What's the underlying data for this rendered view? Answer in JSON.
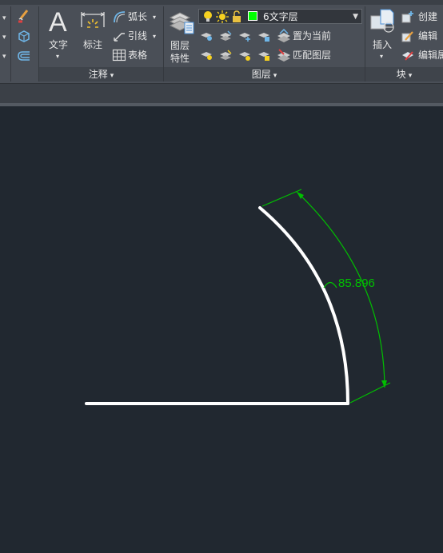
{
  "annotation_panel": {
    "text_label": "文字",
    "dimension_label": "标注",
    "arc_length_label": "弧长",
    "leader_label": "引线",
    "table_label": "表格",
    "title": "注释"
  },
  "layers_panel": {
    "layer_properties_label_1": "图层",
    "layer_properties_label_2": "特性",
    "current_layer": "6文字层",
    "current_layer_color": "#00ff00",
    "set_current_label": "置为当前",
    "match_layer_label": "匹配图层",
    "title": "图层"
  },
  "block_panel": {
    "insert_label": "插入",
    "create_label": "创建",
    "edit_label": "编辑",
    "edit_attr_label": "编辑属",
    "title": "块"
  },
  "drawing": {
    "dimension_value": "85.896",
    "background": "#212830",
    "line_color": "#ffffff",
    "dimension_color": "#00c000"
  },
  "icons": [
    "brush-icon",
    "cube-icon",
    "offset-icon",
    "text-A-icon",
    "dimension-icon",
    "arc-length-icon",
    "leader-icon",
    "table-icon",
    "layer-properties-icon",
    "bulb-icon",
    "sun-icon",
    "lock-icon",
    "insert-block-icon",
    "create-block-icon",
    "edit-block-icon",
    "edit-attribute-icon"
  ]
}
